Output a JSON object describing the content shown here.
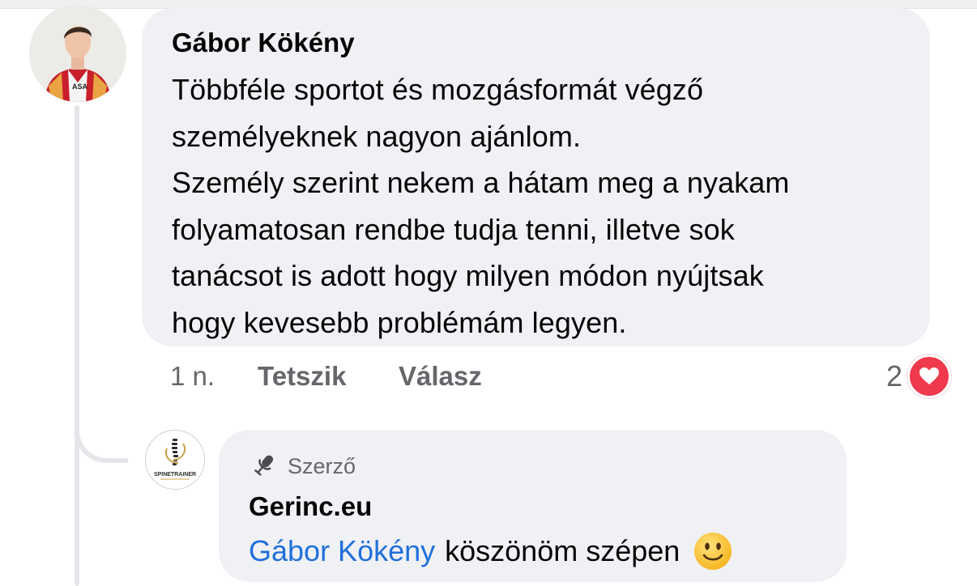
{
  "comment": {
    "author": "Gábor Kökény",
    "text": "Többféle sportot és mozgásformát végző\nszemélyeknek nagyon ajánlom.\nSzemély szerint nekem a hátam meg a nyakam\nfolyamatosan rendbe tudja tenni, illetve sok\ntanácsot is adott hogy milyen módon nyújtsak\nhogy kevesebb problémám legyen.",
    "time": "1 n.",
    "like_label": "Tetszik",
    "reply_label": "Válasz",
    "reaction_count": "2",
    "reaction_icon": "heart-icon",
    "reaction_color": "#f0394d",
    "avatar_icon": "user-avatar"
  },
  "reply": {
    "badge_label": "Szerző",
    "badge_icon": "microphone-icon",
    "author": "Gerinc.eu",
    "mention": "Gábor Kökény",
    "text": "köszönöm szépen",
    "emoji_icon": "smiling-face-emoji",
    "avatar_logo_text": "SPINETRAINER",
    "mention_color": "#216fdb"
  },
  "colors": {
    "bubble_bg": "#f0f1f4",
    "secondary_text": "#65676b",
    "primary_text": "#050505"
  }
}
